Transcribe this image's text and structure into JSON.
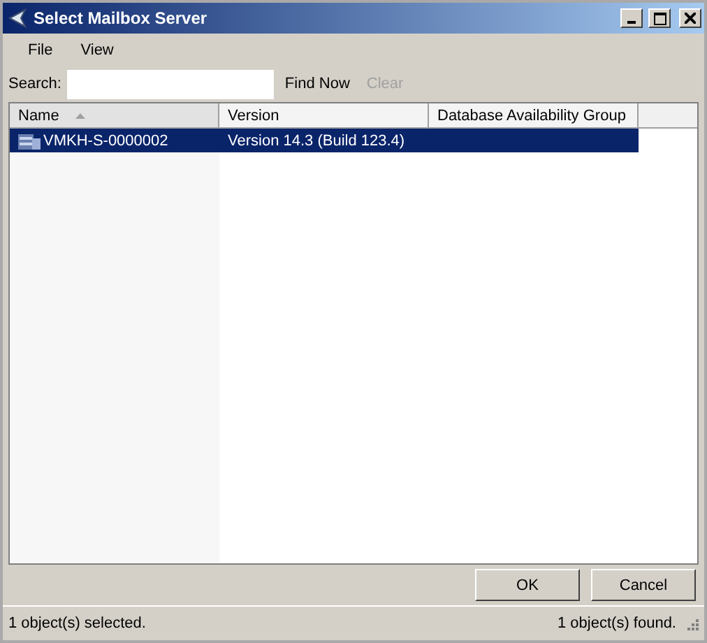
{
  "window": {
    "title": "Select Mailbox Server"
  },
  "menu": [
    "File",
    "View"
  ],
  "search": {
    "label": "Search:",
    "find_now": {
      "label": "Find Now",
      "disabled": false
    },
    "clear": {
      "label": "Clear",
      "disabled": true
    }
  },
  "table": {
    "columns": [
      {
        "label": "Name",
        "sorted": true
      },
      {
        "label": "Version",
        "sorted": false
      },
      {
        "label": "Database Availability Group",
        "sorted": false
      }
    ],
    "rows": [
      {
        "cells": [
          "VMKH-S-0000002",
          "Version 14.3 (Build 123.4)",
          ""
        ],
        "selected": true
      }
    ]
  },
  "buttons": [
    "OK",
    "Cancel"
  ],
  "status_bar": {
    "left": "1 object(s) selected.",
    "right": "1 object(s) found."
  }
}
